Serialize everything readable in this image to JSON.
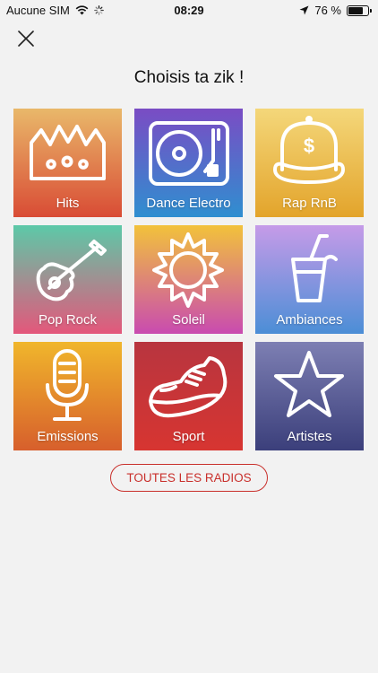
{
  "status_bar": {
    "carrier": "Aucune SIM",
    "time": "08:29",
    "battery": "76 %",
    "battery_level": 0.76,
    "icons": [
      "wifi-icon",
      "loading-icon",
      "location-arrow-icon",
      "battery-icon"
    ]
  },
  "header": {
    "close_icon": "close-icon",
    "title": "Choisis ta zik !"
  },
  "categories": [
    {
      "label": "Hits",
      "icon": "crown-icon",
      "colors": [
        "#e9b86a",
        "#d94c35"
      ]
    },
    {
      "label": "Dance Electro",
      "icon": "turntable-icon",
      "colors": [
        "#7a4cc4",
        "#2f8fd0"
      ]
    },
    {
      "label": "Rap RnB",
      "icon": "cap-icon",
      "colors": [
        "#f4d77a",
        "#e3a42b"
      ]
    },
    {
      "label": "Pop Rock",
      "icon": "guitar-icon",
      "colors": [
        "#5cc9a8",
        "#e4577b"
      ]
    },
    {
      "label": "Soleil",
      "icon": "sun-icon",
      "colors": [
        "#f2c23b",
        "#c94bb0"
      ]
    },
    {
      "label": "Ambiances",
      "icon": "cocktail-icon",
      "colors": [
        "#c69be8",
        "#4b8ed6"
      ]
    },
    {
      "label": "Emissions",
      "icon": "microphone-icon",
      "colors": [
        "#f0b62c",
        "#d75f2c"
      ]
    },
    {
      "label": "Sport",
      "icon": "sneaker-icon",
      "colors": [
        "#b8353f",
        "#d73531"
      ]
    },
    {
      "label": "Artistes",
      "icon": "star-icon",
      "colors": [
        "#7d7fb3",
        "#3b3f7b"
      ]
    }
  ],
  "all_radios_button": "TOUTES LES RADIOS",
  "accent_color": "#c9302c"
}
